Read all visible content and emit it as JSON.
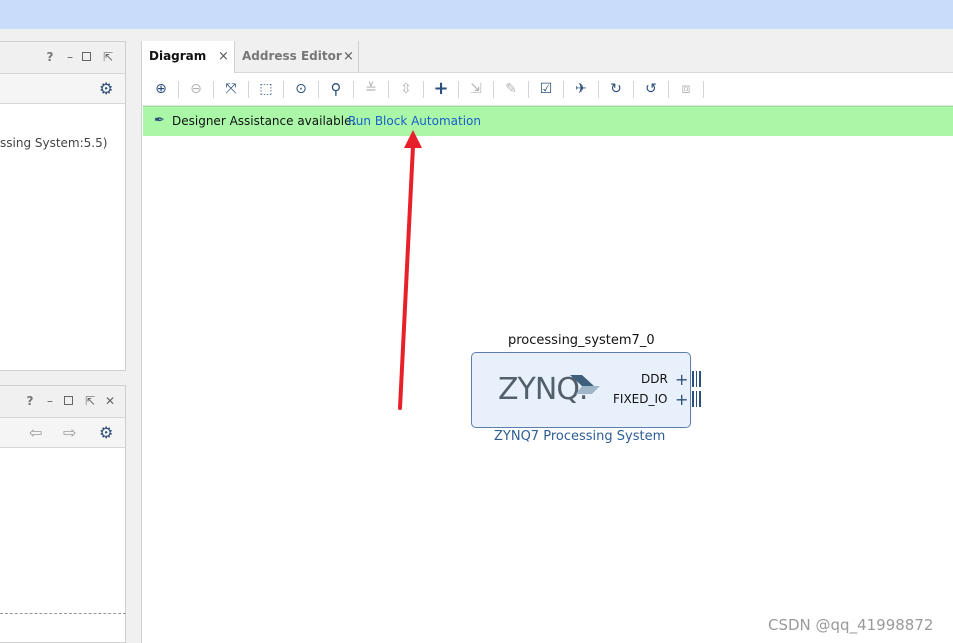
{
  "left_panel_top": {
    "help": "?",
    "tree_text": "ssing System:5.5)"
  },
  "left_panel_bottom": {
    "help": "?",
    "close": "✕"
  },
  "tabs": [
    {
      "label": "Diagram",
      "close": "×"
    },
    {
      "label": "Address Editor",
      "close": "×"
    }
  ],
  "toolbar_icons": [
    "zoom-in-icon",
    "zoom-out-icon",
    "zoom-fit-icon",
    "fit-selection-icon",
    "target-icon",
    "search-icon",
    "collapse-icon",
    "expand-icon",
    "add-ip-icon",
    "make-connection-icon",
    "wrench-icon",
    "validate-icon",
    "pin-icon",
    "refresh-icon",
    "regenerate-layout-icon",
    "optimize-routing-icon"
  ],
  "assistance": {
    "text": "Designer Assistance available.",
    "link": "Run Block Automation"
  },
  "block": {
    "instance_name": "processing_system7_0",
    "logo": "ZYNQ.",
    "ports": [
      "DDR",
      "FIXED_IO"
    ],
    "ip_name": "ZYNQ7 Processing System"
  },
  "colors": {
    "titlebar": "#c9ddfb",
    "assist_bar": "#aaf7a8",
    "link": "#1a5fc8",
    "annotation_arrow": "#e8202a"
  },
  "watermark": "CSDN @qq_41998872"
}
